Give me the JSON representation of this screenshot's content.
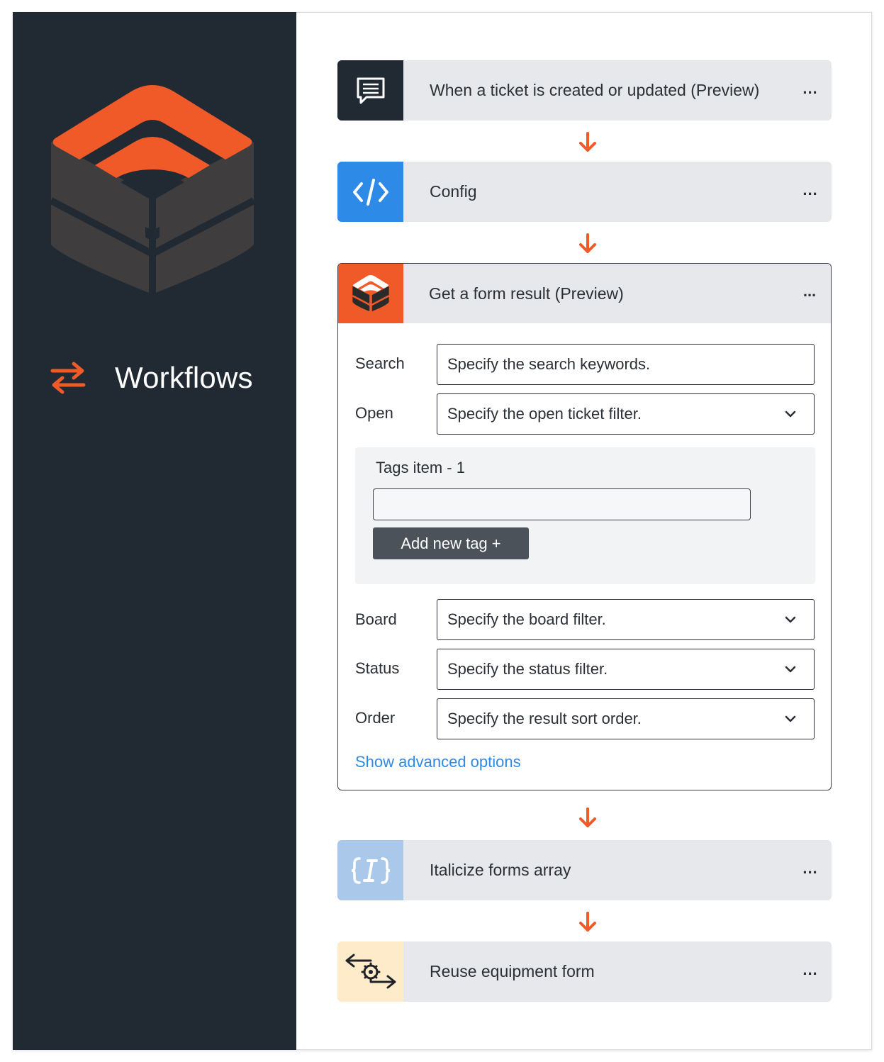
{
  "sidebar": {
    "nav_label": "Workflows",
    "accent_color": "#f05a28",
    "background_color": "#212a33",
    "icons": [
      "product-logo-icon",
      "workflows-swap-arrows-icon"
    ]
  },
  "steps": [
    {
      "title": "When a ticket is created or updated (Preview)",
      "more": "...",
      "icon": "chat-message-icon",
      "tile_color": "#212a33"
    },
    {
      "title": "Config",
      "more": "...",
      "icon": "code-brackets-icon",
      "tile_color": "#2d8ae6"
    },
    {
      "title": "Get a form result (Preview)",
      "more": "...",
      "icon": "product-logo-icon",
      "tile_color": "#f05a28",
      "expanded": true
    },
    {
      "title": "Italicize forms array",
      "more": "...",
      "icon": "italic-braces-icon",
      "tile_color": "#a9c8ea"
    },
    {
      "title": "Reuse equipment form",
      "more": "...",
      "icon": "gear-arrows-icon",
      "tile_color": "#fdebc9"
    }
  ],
  "form": {
    "search": {
      "label": "Search",
      "placeholder": "Specify the search keywords."
    },
    "open": {
      "label": "Open",
      "placeholder": "Specify the open ticket filter."
    },
    "tags": {
      "title": "Tags item - 1",
      "value": "",
      "add_label": "Add new tag  +"
    },
    "board": {
      "label": "Board",
      "placeholder": "Specify the board filter."
    },
    "status": {
      "label": "Status",
      "placeholder": "Specify the status filter."
    },
    "order": {
      "label": "Order",
      "placeholder": "Specify the result sort order."
    },
    "advanced_link": "Show advanced options"
  }
}
